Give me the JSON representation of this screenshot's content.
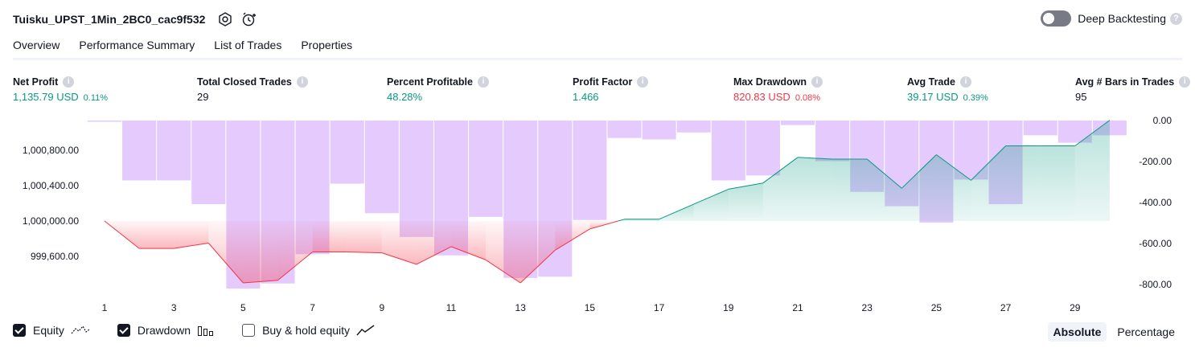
{
  "header": {
    "strategy_name": "Tuisku_UPST_1Min_2BC0_cac9f532",
    "deep_backtesting_label": "Deep Backtesting",
    "help_glyph": "?"
  },
  "tabs": [
    {
      "label": "Overview",
      "active": true
    },
    {
      "label": "Performance Summary",
      "active": false
    },
    {
      "label": "List of Trades",
      "active": false
    },
    {
      "label": "Properties",
      "active": false
    }
  ],
  "metrics": {
    "net_profit": {
      "label": "Net Profit",
      "value": "1,135.79 USD",
      "pct": "0.11%"
    },
    "total_closed_trades": {
      "label": "Total Closed Trades",
      "value": "29"
    },
    "percent_profitable": {
      "label": "Percent Profitable",
      "value": "48.28%"
    },
    "profit_factor": {
      "label": "Profit Factor",
      "value": "1.466"
    },
    "max_drawdown": {
      "label": "Max Drawdown",
      "value": "820.83 USD",
      "pct": "0.08%"
    },
    "avg_trade": {
      "label": "Avg Trade",
      "value": "39.17 USD",
      "pct": "0.39%"
    },
    "avg_bars": {
      "label": "Avg # Bars in Trades",
      "value": "95"
    }
  },
  "info_glyph": "i",
  "legend": {
    "equity_label": "Equity",
    "drawdown_label": "Drawdown",
    "buyhold_label": "Buy & hold equity"
  },
  "modes": {
    "absolute": "Absolute",
    "percentage": "Percentage"
  },
  "colors": {
    "positive": "#089981",
    "negative": "#f23645",
    "drawdown_bar": "#e1c4fd",
    "equity_fill": "#a9dfd2"
  },
  "chart_data": {
    "type": "bar",
    "x": [
      1,
      2,
      3,
      4,
      5,
      6,
      7,
      8,
      9,
      10,
      11,
      12,
      13,
      14,
      15,
      16,
      17,
      18,
      19,
      20,
      21,
      22,
      23,
      24,
      25,
      26,
      27,
      28,
      29,
      30
    ],
    "x_tick_labels": [
      "1",
      "3",
      "5",
      "7",
      "9",
      "11",
      "13",
      "15",
      "17",
      "19",
      "21",
      "23",
      "25",
      "27",
      "29"
    ],
    "left_axis": {
      "ticks": [
        "1,000,800.00",
        "1,000,400.00",
        "1,000,000.00",
        "999,600.00"
      ],
      "range": [
        999200,
        1001150
      ]
    },
    "right_axis": {
      "ticks": [
        "0.00",
        "-200.00",
        "-400.00",
        "-600.00",
        "-800.00"
      ],
      "range": [
        -840,
        0
      ]
    },
    "series": [
      {
        "name": "Drawdown",
        "type": "bar",
        "axis": "right",
        "values": [
          0,
          -292,
          -292,
          -408,
          -820,
          -795,
          -652,
          -308,
          -452,
          -568,
          -658,
          -470,
          -768,
          -762,
          -485,
          -85,
          -92,
          -58,
          -292,
          -268,
          -22,
          -198,
          -348,
          -418,
          -498,
          -288,
          -408,
          -72,
          -108,
          -72
        ]
      },
      {
        "name": "Equity",
        "type": "line",
        "axis": "left",
        "values": [
          1000000,
          999690,
          999690,
          999750,
          999300,
          999330,
          999650,
          999650,
          999640,
          999510,
          999710,
          999560,
          999300,
          999670,
          999910,
          1000020,
          1000020,
          1000190,
          1000360,
          1000430,
          1000720,
          1000700,
          1000700,
          1000370,
          1000750,
          1000460,
          1000850,
          1000850,
          1000850,
          1001140
        ]
      }
    ]
  }
}
